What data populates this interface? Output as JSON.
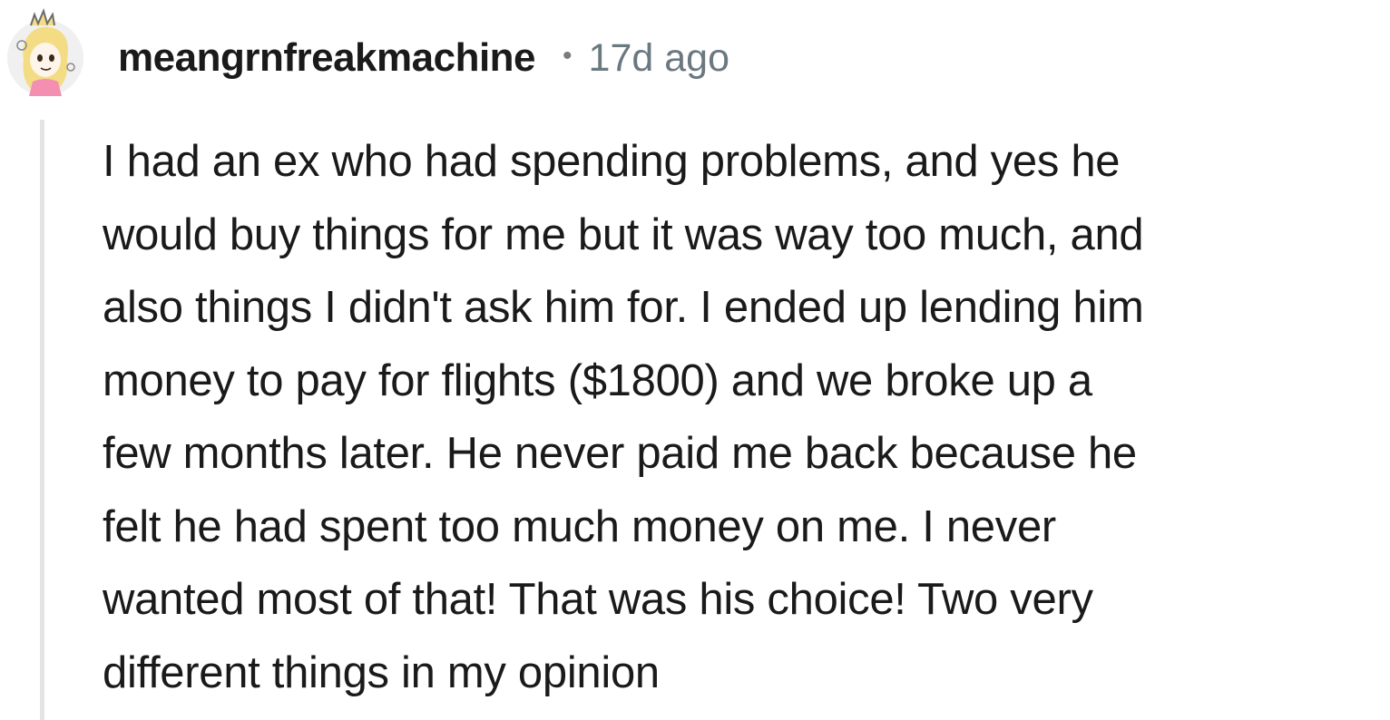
{
  "comment": {
    "username": "meangrnfreakmachine",
    "separator": "•",
    "timestamp": "17d ago",
    "avatar_icon": "cartoon-girl-avatar-icon",
    "body_lines": [
      "I had an ex who had spending problems, and yes he",
      "would buy things for me but it was way too much, and",
      "also things I didn't ask him for. I ended up lending him",
      "money to pay for flights ($1800) and we broke up a",
      "few months later. He never paid me back because he",
      "felt he had spent too much money on me. I never",
      "wanted most of that! That was his choice! Two very",
      "different things in my opinion"
    ]
  },
  "colors": {
    "username": "#1a1a1b",
    "timestamp": "#6a7880",
    "thread_line": "#e4e4e4",
    "body_text": "#1a1a1b"
  }
}
